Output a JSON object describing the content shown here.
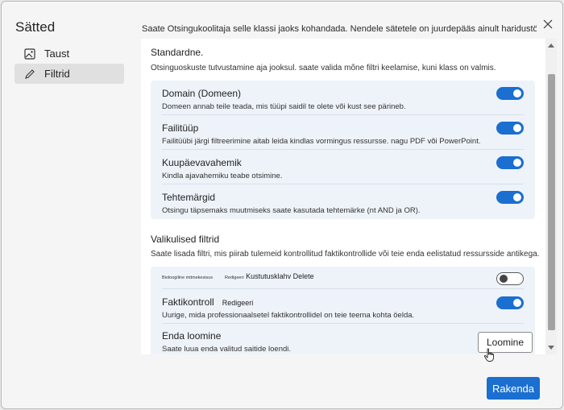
{
  "sidebar": {
    "title": "Sätted",
    "items": [
      {
        "label": "Taust",
        "icon": "image-icon",
        "active": false
      },
      {
        "label": "Filtrid",
        "icon": "pencil-icon",
        "active": true
      }
    ]
  },
  "intro": "Saate Otsingukoolitaja selle klassi jaoks kohandada. Nendele sätetele on juurdepääs ainult haridustöötajatel.",
  "standard": {
    "heading": "Standardne.",
    "description": "Otsinguoskuste tutvustamine aja jooksul. saate valida mõne filtri keelamise, kuni klass on valmis.",
    "rows": [
      {
        "title": "Domain (Domeen)",
        "desc": "Domeen annab teile teada, mis tüüpi saidil te olete või kust see pärineb.",
        "enabled": true
      },
      {
        "title": "Failitüüp",
        "desc": "Failitüübi järgi filtreerimine aitab leida kindlas vormingus ressursse. nagu PDF või PowerPoint.",
        "enabled": true
      },
      {
        "title": "Kuupäevavahemik",
        "desc": "Kindla ajavahemiku teabe otsimine.",
        "enabled": true
      },
      {
        "title": "Tehtemärgid",
        "desc": "Otsingu täpsemaks muutmiseks saate kasutada tehtemärke (nt AND ja OR).",
        "enabled": true
      }
    ]
  },
  "optional": {
    "heading": "Valikulised filtrid",
    "description": "Saate lisada filtri, mis piirab tulemeid kontrollitud faktikontrollide või teie enda eelistatud ressursside antikega.",
    "row1": {
      "tiny_a": "Bioloogiline mitmekesisus",
      "tiny_b": "Redigeeri",
      "label": "Kustutusklahv Delete",
      "enabled": false
    },
    "row2": {
      "title": "Faktikontroll",
      "edit": "Redigeeri",
      "desc": "Uurige, mida professionaalsetel faktikontrollidel on teie teema kohta öelda.",
      "enabled": true
    },
    "row3": {
      "title": "Enda loomine",
      "desc": "Saate luua enda valitud saitide loendi.",
      "button": "Loomine"
    }
  },
  "footer": {
    "apply": "Rakenda"
  },
  "colors": {
    "accent": "#1a6fd0",
    "group_bg": "#eef3f9"
  }
}
